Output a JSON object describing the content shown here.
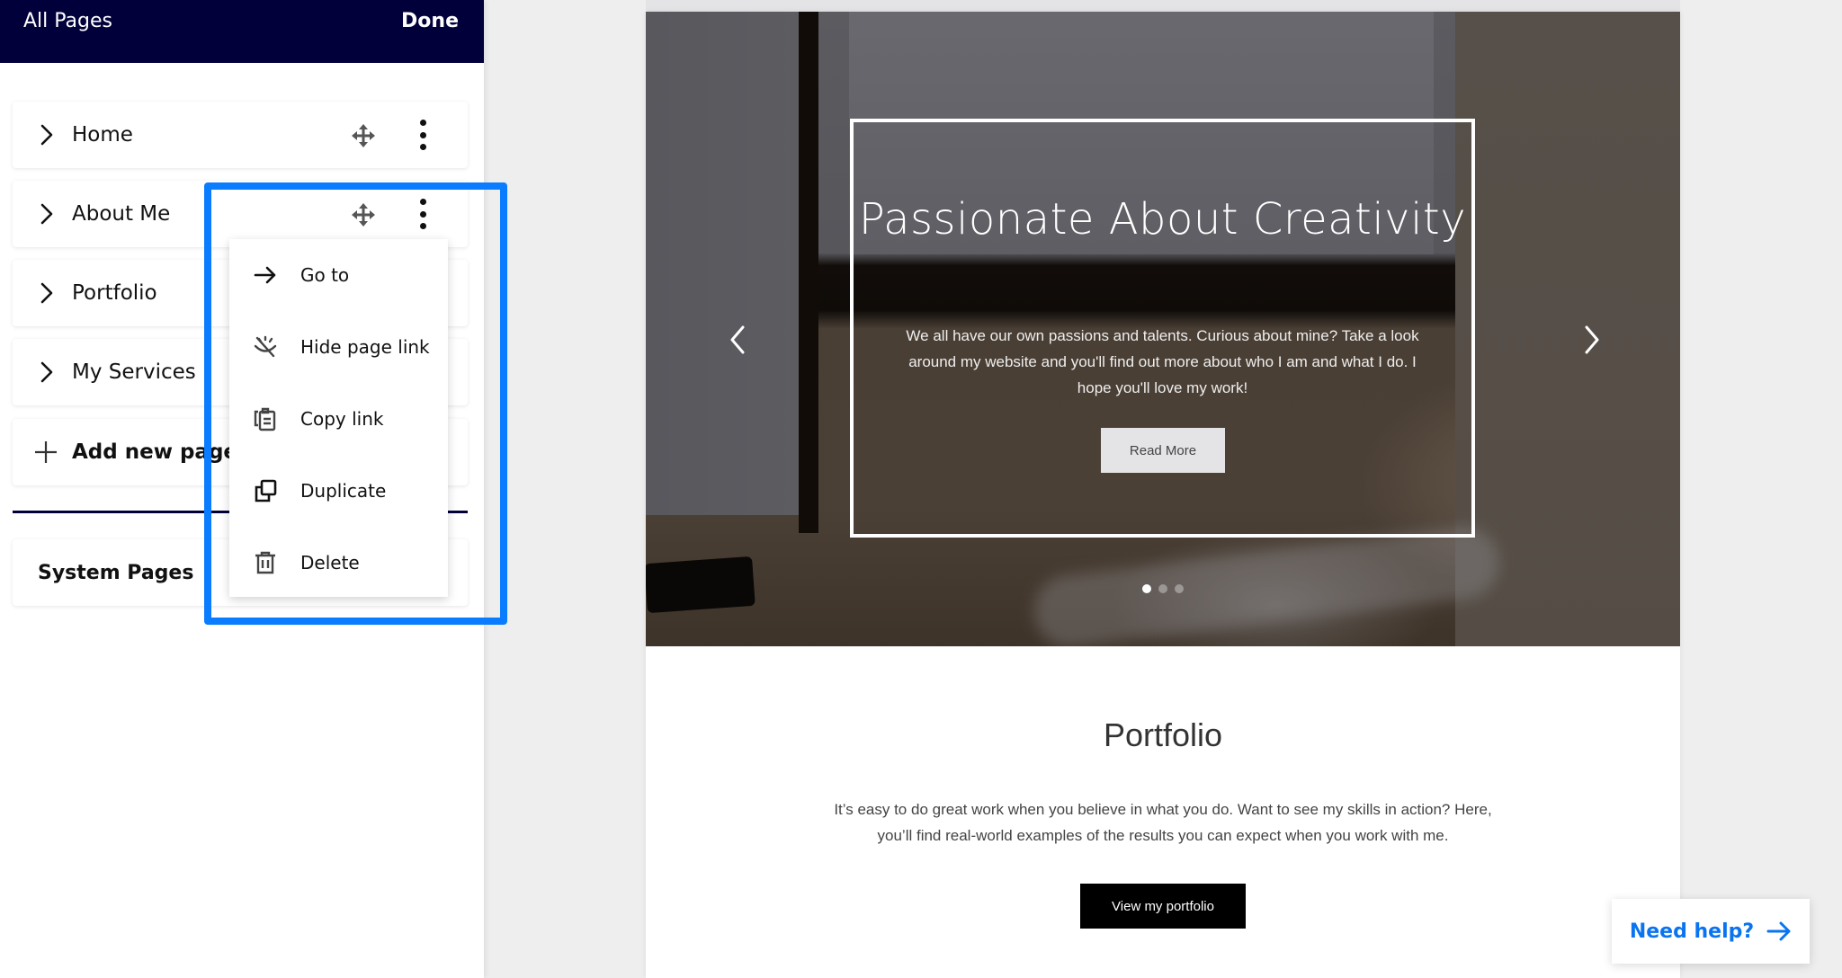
{
  "sidebar": {
    "title": "All Pages",
    "done_label": "Done",
    "pages": [
      {
        "label": "Home"
      },
      {
        "label": "About Me"
      },
      {
        "label": "Portfolio"
      },
      {
        "label": "My Services"
      }
    ],
    "add_page_label": "Add new page",
    "system_pages_label": "System Pages"
  },
  "context_menu": {
    "target_page": "About Me",
    "items": [
      {
        "label": "Go to",
        "icon": "arrow-right-icon"
      },
      {
        "label": "Hide page link",
        "icon": "eye-off-icon"
      },
      {
        "label": "Copy link",
        "icon": "copy-link-icon"
      },
      {
        "label": "Duplicate",
        "icon": "duplicate-icon"
      },
      {
        "label": "Delete",
        "icon": "trash-icon"
      }
    ]
  },
  "highlight_color": "#0a7cff",
  "header_color": "#01003a",
  "preview": {
    "hero": {
      "title": "Passionate About Creativity",
      "text": "We all have our own passions and talents. Curious about mine? Take a look around my website and you'll find out more about who I am and what I do. I hope you'll love my work!",
      "button_label": "Read More",
      "slides_count": 3,
      "active_slide": 1
    },
    "portfolio": {
      "title": "Portfolio",
      "text": "It’s easy to do great work when you believe in what you do. Want to see my skills in action? Here, you’ll find real-world examples of the results you can expect when you work with me.",
      "button_label": "View my portfolio"
    }
  },
  "help": {
    "label": "Need help?",
    "color": "#0a74f0"
  }
}
